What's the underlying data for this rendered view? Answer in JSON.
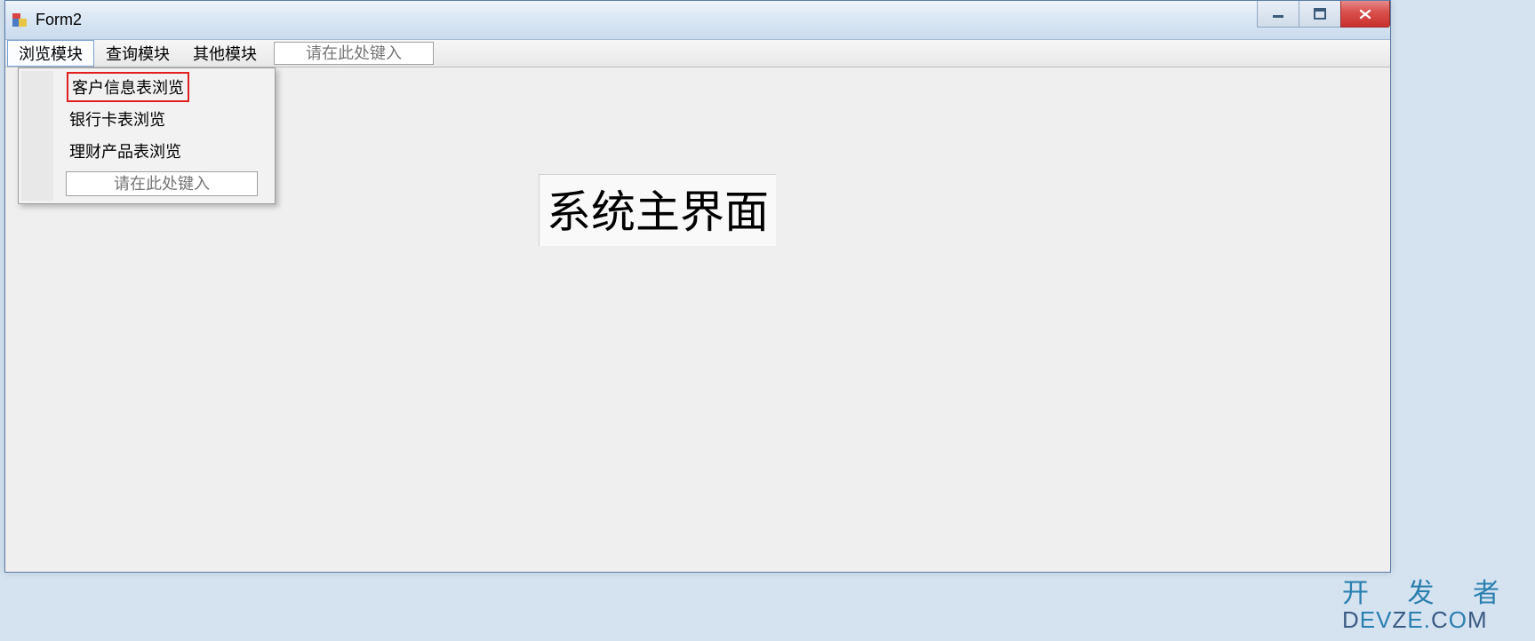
{
  "window": {
    "title": "Form2"
  },
  "menubar": {
    "items": [
      {
        "label": "浏览模块",
        "active": true
      },
      {
        "label": "查询模块",
        "active": false
      },
      {
        "label": "其他模块",
        "active": false
      }
    ],
    "input_placeholder": "请在此处键入"
  },
  "dropdown": {
    "items": [
      {
        "label": "客户信息表浏览",
        "highlighted": true
      },
      {
        "label": "银行卡表浏览",
        "highlighted": false
      },
      {
        "label": "理财产品表浏览",
        "highlighted": false
      }
    ],
    "input_placeholder": "请在此处键入"
  },
  "main": {
    "heading": "系统主界面"
  },
  "watermark": {
    "line1": "开 发 者",
    "line2_a": "D",
    "line2_b": "EV",
    "line2_c": "Z",
    "line2_d": "E.",
    "line2_e": "C",
    "line2_f": "O",
    "line2_g": "M"
  }
}
